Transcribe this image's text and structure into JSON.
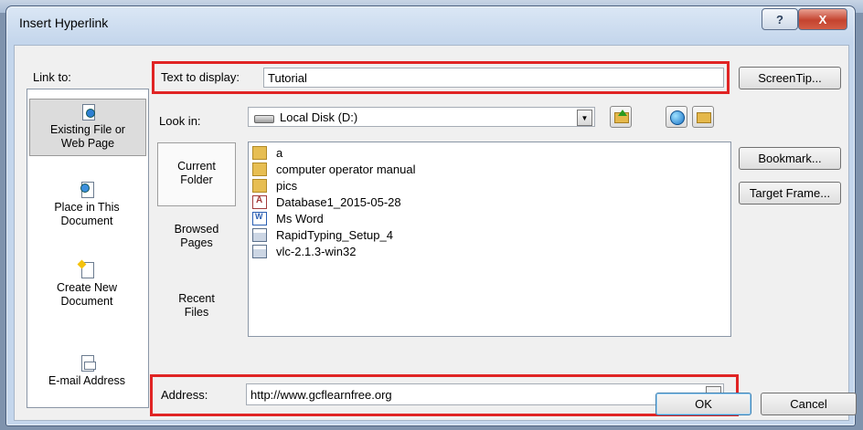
{
  "dialog": {
    "title": "Insert Hyperlink",
    "help_label": "?",
    "close_label": "X"
  },
  "link_to": {
    "label": "Link to:",
    "items": [
      {
        "line1": "Existing File or",
        "line2": "Web Page",
        "icon": "existing-file-icon",
        "selected": true
      },
      {
        "line1": "Place in This",
        "line2": "Document",
        "icon": "place-in-document-icon",
        "selected": false
      },
      {
        "line1": "Create New",
        "line2": "Document",
        "icon": "create-new-document-icon",
        "selected": false
      },
      {
        "line1": "E-mail Address",
        "line2": "",
        "icon": "email-icon",
        "selected": false
      }
    ]
  },
  "text_to_display": {
    "label": "Text to display:",
    "value": "Tutorial"
  },
  "look_in": {
    "label": "Look in:",
    "value": "Local Disk (D:)"
  },
  "side_tabs": [
    {
      "line1": "Current",
      "line2": "Folder",
      "selected": true
    },
    {
      "line1": "Browsed",
      "line2": "Pages",
      "selected": false
    },
    {
      "line1": "Recent",
      "line2": "Files",
      "selected": false
    }
  ],
  "files": [
    {
      "name": "a",
      "type": "folder"
    },
    {
      "name": "computer operator manual",
      "type": "folder"
    },
    {
      "name": "pics",
      "type": "folder"
    },
    {
      "name": "Database1_2015-05-28",
      "type": "access"
    },
    {
      "name": "Ms Word",
      "type": "word"
    },
    {
      "name": "RapidTyping_Setup_4",
      "type": "exe"
    },
    {
      "name": "vlc-2.1.3-win32",
      "type": "exe"
    }
  ],
  "buttons": {
    "screentip": "ScreenTip...",
    "bookmark": "Bookmark...",
    "target_frame": "Target Frame...",
    "ok": "OK",
    "cancel": "Cancel"
  },
  "address": {
    "label": "Address:",
    "value": "http://www.gcflearnfree.org"
  },
  "colors": {
    "highlight_box": "#e02424",
    "dialog_bg": "#f0f0f0"
  }
}
